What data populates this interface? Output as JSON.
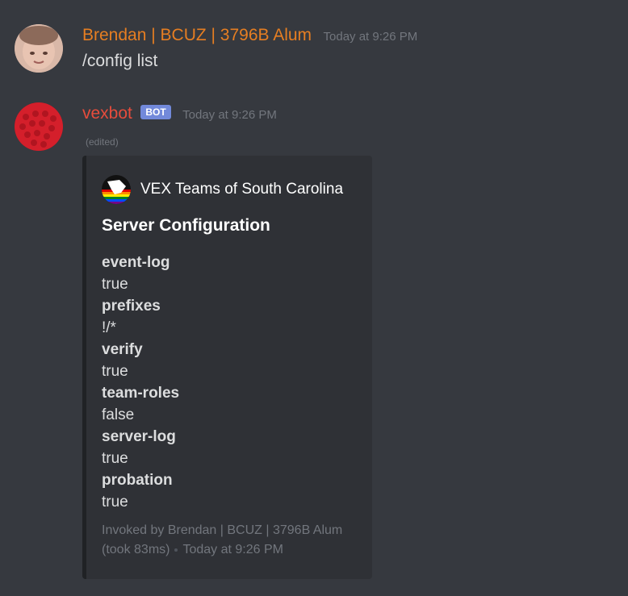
{
  "messages": [
    {
      "username": "Brendan | BCUZ | 3796B Alum",
      "username_color": "#e67e22",
      "timestamp": "Today at 9:26 PM",
      "content": "/config list"
    },
    {
      "username": "vexbot",
      "username_color": "#e74c3c",
      "bot_tag": "BOT",
      "timestamp": "Today at 9:26 PM",
      "edited": "(edited)",
      "embed": {
        "author": "VEX Teams of South Carolina",
        "title": "Server Configuration",
        "fields": [
          {
            "name": "event-log",
            "value": "true"
          },
          {
            "name": "prefixes",
            "value": "!/*"
          },
          {
            "name": "verify",
            "value": "true"
          },
          {
            "name": "team-roles",
            "value": "false"
          },
          {
            "name": "server-log",
            "value": "true"
          },
          {
            "name": "probation",
            "value": "true"
          }
        ],
        "footer_line1": "Invoked by Brendan | BCUZ | 3796B Alum",
        "footer_took": "(took 83ms)",
        "footer_time": "Today at 9:26 PM"
      }
    }
  ],
  "colors": {
    "background": "#36393f",
    "embed_background": "#2f3136",
    "bot_tag": "#7289da",
    "muted": "#72767d"
  }
}
